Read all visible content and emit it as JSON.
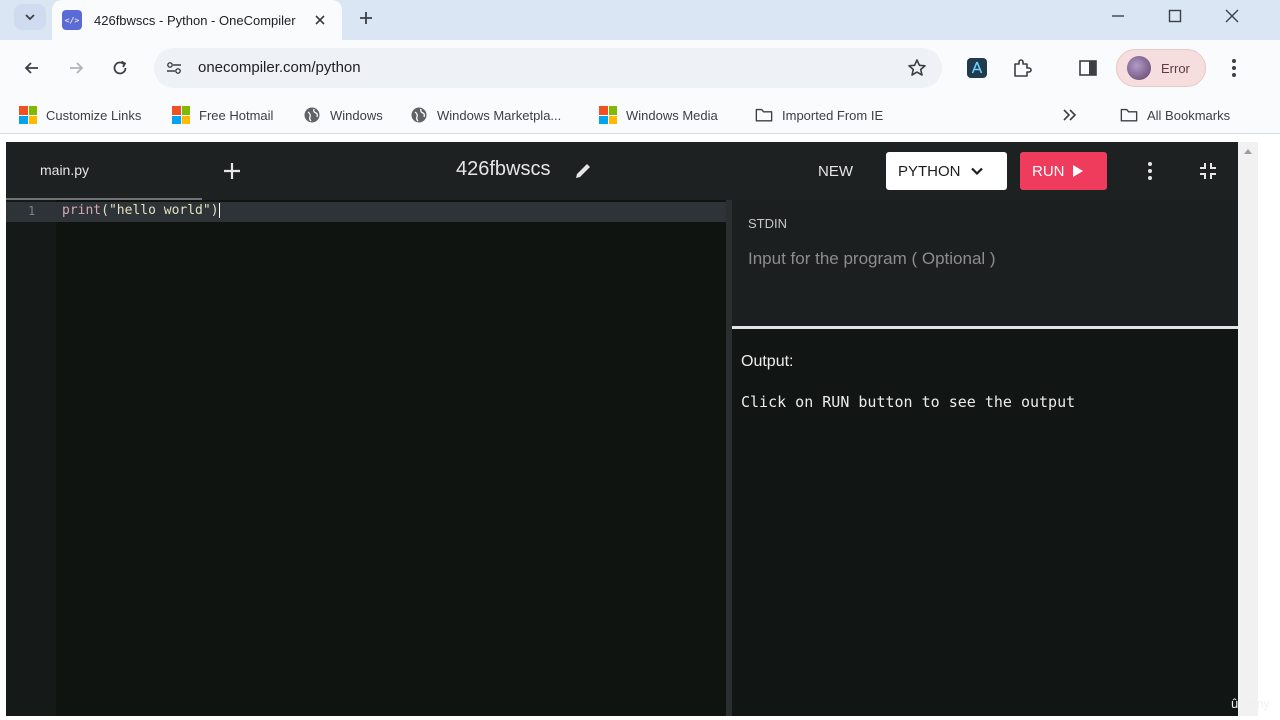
{
  "browser": {
    "tab_title": "426fbwscs - Python - OneCompiler",
    "favicon_text": "</>",
    "url": "onecompiler.com/python",
    "profile_label": "Error",
    "bookmarks": [
      {
        "label": "Customize Links",
        "icon": "microsoft-icon"
      },
      {
        "label": "Free Hotmail",
        "icon": "microsoft-icon"
      },
      {
        "label": "Windows",
        "icon": "globe-icon"
      },
      {
        "label": "Windows Marketpla...",
        "icon": "globe-icon"
      },
      {
        "label": "Windows Media",
        "icon": "microsoft-icon"
      },
      {
        "label": "Imported From IE",
        "icon": "folder-icon"
      }
    ],
    "all_bookmarks": "All Bookmarks"
  },
  "app": {
    "file_tab": "main.py",
    "title": "426fbwscs",
    "new_label": "NEW",
    "language": "PYTHON",
    "run_label": "RUN",
    "accent_color": "#ef3b5c",
    "editor": {
      "line_number": "1",
      "code_fn": "print",
      "code_rest": "(\"hello world\")"
    },
    "stdin_label": "STDIN",
    "stdin_placeholder": "Input for the program ( Optional )",
    "output_label": "Output:",
    "output_text": "Click on RUN button to see the output"
  },
  "watermark": "ûdemy"
}
